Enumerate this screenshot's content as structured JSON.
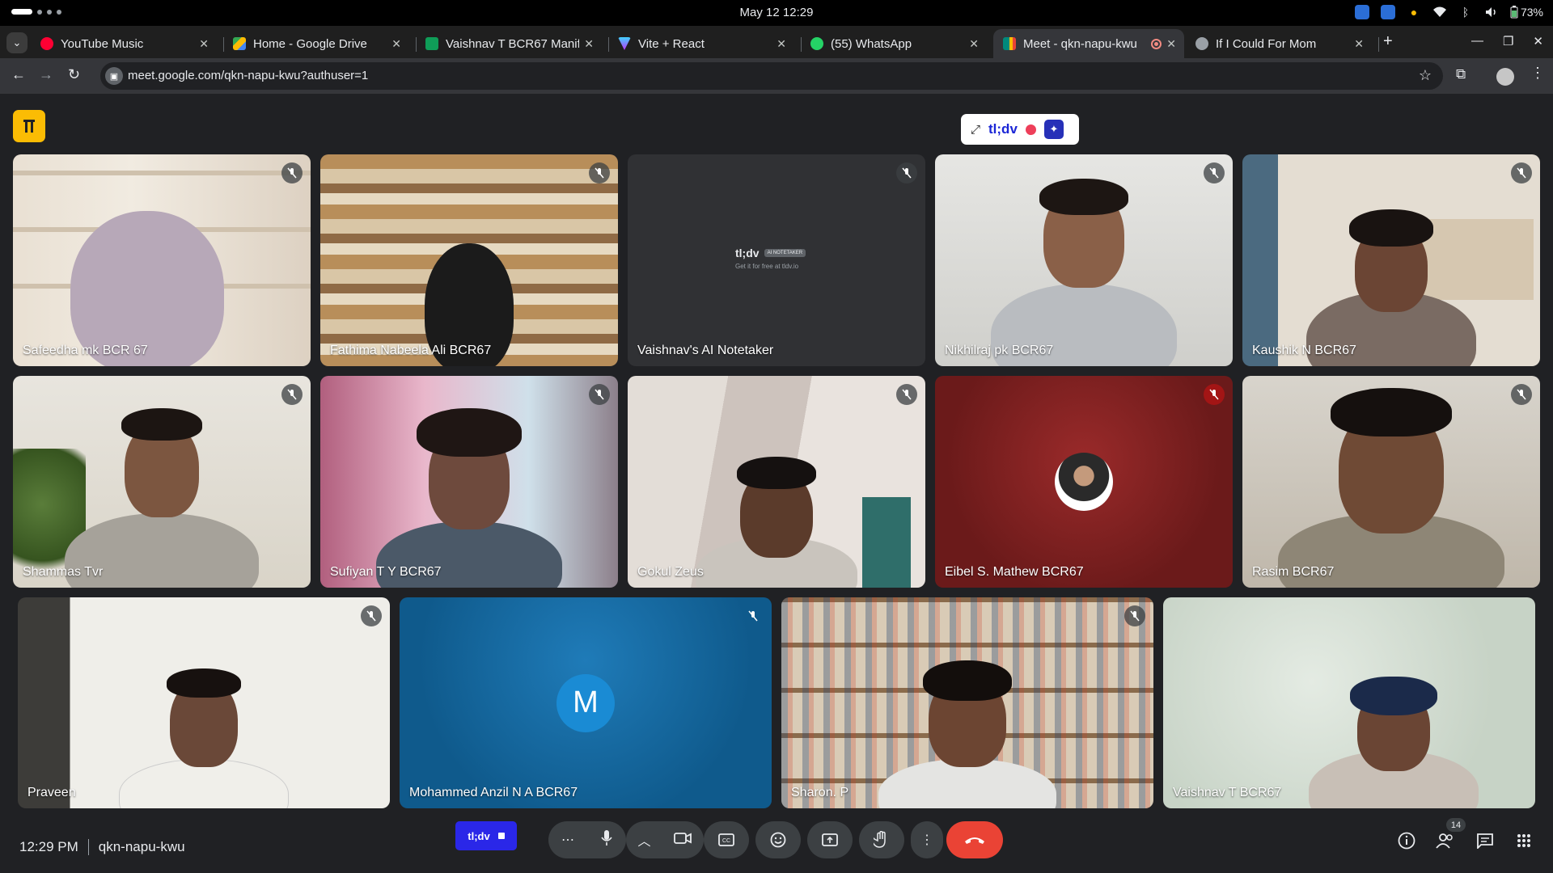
{
  "os": {
    "clock": "May 12  12:29",
    "battery": "73%"
  },
  "tabs": [
    {
      "title": "YouTube Music",
      "color": "#ff0033"
    },
    {
      "title": "Home - Google Drive",
      "color": "#fbbc04"
    },
    {
      "title": "Vaishnav T BCR67 Manife",
      "color": "#0f9d58"
    },
    {
      "title": "Vite + React",
      "color": "#bd34fe"
    },
    {
      "title": "(55) WhatsApp",
      "color": "#25d366"
    },
    {
      "title": "Meet - qkn-napu-kwu",
      "color": "#00897b"
    },
    {
      "title": "If I Could For Mom",
      "color": "#9aa0a6"
    }
  ],
  "address": {
    "url": "meet.google.com/qkn-napu-kwu?authuser=1"
  },
  "tldv": {
    "brand": "tl;dv",
    "expand_symbol": "⤢"
  },
  "participants": [
    {
      "name": "Safeedha mk BCR 67"
    },
    {
      "name": "Fathima Nabeela Ali BCR67"
    },
    {
      "name": "Vaishnav's AI Notetaker",
      "logo": "tl;dv",
      "badge": "AI NOTETAKER",
      "tagline": "Get it for free at tldv.io"
    },
    {
      "name": "Nikhilraj pk BCR67"
    },
    {
      "name": "Kaushik N BCR67"
    },
    {
      "name": "Shammas Tvr"
    },
    {
      "name": "Sufiyan T Y BCR67"
    },
    {
      "name": "Gokul Zeus"
    },
    {
      "name": "Eibel S. Mathew BCR67"
    },
    {
      "name": "Rasim BCR67"
    },
    {
      "name": "Praveen"
    },
    {
      "name": "Mohammed Anzil N A BCR67",
      "initial": "M"
    },
    {
      "name": "Sharon. P"
    },
    {
      "name": "Vaishnav T BCR67"
    }
  ],
  "bottom": {
    "time": "12:29 PM",
    "code": "qkn-napu-kwu",
    "tldv_label": "tl;dv",
    "people_count": "14"
  }
}
